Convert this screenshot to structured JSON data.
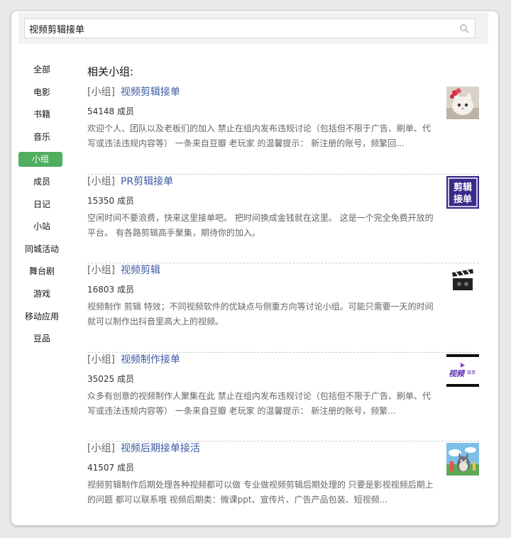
{
  "search": {
    "query": "视频剪辑接单"
  },
  "sidebar": {
    "items": [
      {
        "label": "全部",
        "active": false
      },
      {
        "label": "电影",
        "active": false
      },
      {
        "label": "书籍",
        "active": false
      },
      {
        "label": "音乐",
        "active": false
      },
      {
        "label": "小组",
        "active": true
      },
      {
        "label": "成员",
        "active": false
      },
      {
        "label": "日记",
        "active": false
      },
      {
        "label": "小站",
        "active": false
      },
      {
        "label": "同城活动",
        "active": false
      },
      {
        "label": "舞台剧",
        "active": false
      },
      {
        "label": "游戏",
        "active": false
      },
      {
        "label": "移动应用",
        "active": false
      },
      {
        "label": "豆品",
        "active": false
      }
    ]
  },
  "main": {
    "section_title": "相关小组:",
    "results": [
      {
        "type": "[小组]",
        "title": "视频剪辑接单",
        "members": "54148 成员",
        "description": "欢迎个人、团队以及老板们的加入 禁止在组内发布违规讨论（包括但不限于广告、刷单、代写或违法违规内容等） 一条来自豆瓣 老玩家 的温馨提示： 新注册的账号，频繁回...",
        "thumb_icon": "cat-avatar-icon"
      },
      {
        "type": "[小组]",
        "title": "PR剪辑接单",
        "members": "15350 成员",
        "description": "空闲时间不要浪费，快来这里接单吧。 把时间换成金钱就在这里。 这是一个完全免费开放的平台。 有各路剪辑高手聚集，期待你的加入。",
        "thumb_icon": "edit-order-logo-icon",
        "thumb_text_1": "剪辑",
        "thumb_text_2": "接单"
      },
      {
        "type": "[小组]",
        "title": "视频剪辑",
        "members": "16803 成员",
        "description": "视频制作 剪辑 特效；不同视频软件的优缺点与侧重方向等讨论小组。可能只需要一天的时间就可以制作出抖音里高大上的视频。",
        "thumb_icon": "clapperboard-icon"
      },
      {
        "type": "[小组]",
        "title": "视频制作接单",
        "members": "35025 成员",
        "description": "众多有创意的视频制作人聚集在此 禁止在组内发布违规讨论（包括但不限于广告、刷单、代写或违法违规内容等） 一条来自豆瓣 老玩家 的温馨提示： 新注册的账号，频繁...",
        "thumb_icon": "video-order-logo-icon",
        "thumb_text_1": "视频",
        "thumb_text_2": "接单"
      },
      {
        "type": "[小组]",
        "title": "视频后期接单接活",
        "members": "41507 成员",
        "description": "视频剪辑制作后期处理各种视频都可以做 专业做视频剪辑后期处理的 只要是影视视频后期上的问题 都可以联系哦 视频后期类：微课ppt、宣传片、广告产品包装、短视频...",
        "thumb_icon": "anime-scene-icon"
      }
    ]
  },
  "colors": {
    "accent_green": "#4fae5f",
    "link_blue": "#3b5aa4",
    "thumb_purple": "#3a2a8a"
  }
}
